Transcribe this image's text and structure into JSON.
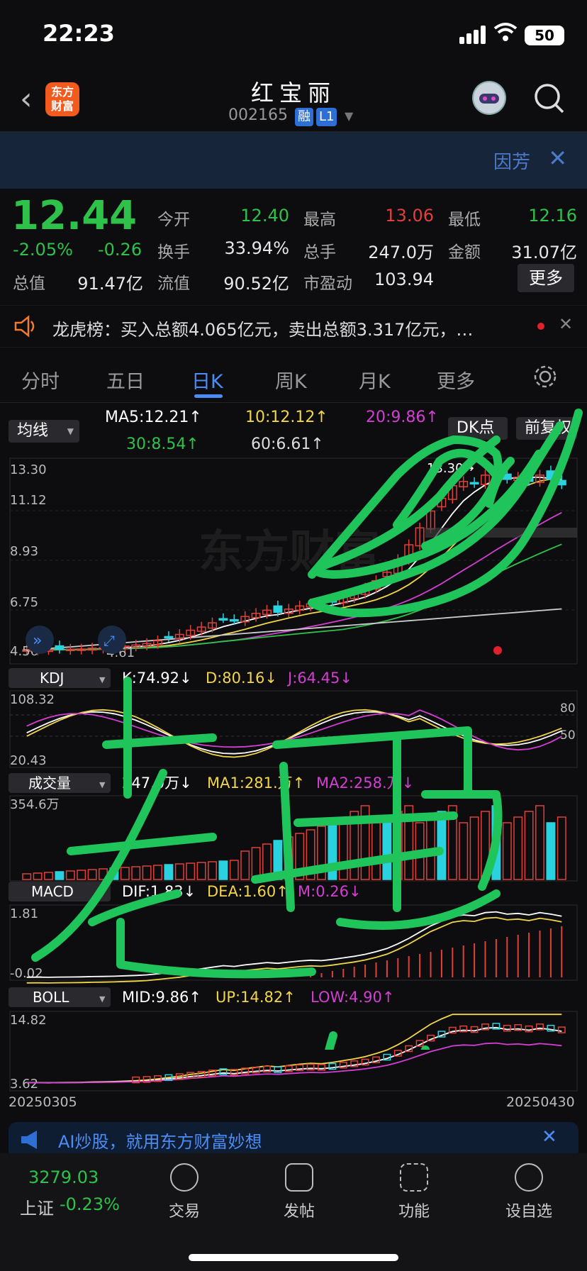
{
  "status": {
    "time": "22:23",
    "battery": "50"
  },
  "header": {
    "stock_name": "红宝丽",
    "stock_code": "002165",
    "tag_margin": "融",
    "tag_level": "L1",
    "logo_line1": "东方",
    "logo_line2": "财富"
  },
  "banner": {
    "text": "因芳"
  },
  "quote": {
    "price": "12.44",
    "pct": "-2.05%",
    "chg": "-0.26",
    "fields": [
      {
        "label": "今开",
        "value": "12.40",
        "color": "#2ec24a"
      },
      {
        "label": "最高",
        "value": "13.06",
        "color": "#e0403a"
      },
      {
        "label": "最低",
        "value": "12.16",
        "color": "#2ec24a"
      },
      {
        "label": "换手",
        "value": "33.94%",
        "color": "#e6e6e6"
      },
      {
        "label": "总手",
        "value": "247.0万",
        "color": "#e6e6e6"
      },
      {
        "label": "金额",
        "value": "31.07亿",
        "color": "#e6e6e6"
      },
      {
        "label": "总值",
        "value": "91.47亿",
        "color": "#e6e6e6"
      },
      {
        "label": "流值",
        "value": "90.52亿",
        "color": "#e6e6e6"
      },
      {
        "label": "市盈动",
        "value": "103.94",
        "color": "#e6e6e6"
      }
    ],
    "more_label": "更多"
  },
  "dragon": {
    "text": "龙虎榜：买入总额4.065亿元，卖出总额3.317亿元，…"
  },
  "tabs": [
    {
      "label": "分时",
      "active": false
    },
    {
      "label": "五日",
      "active": false
    },
    {
      "label": "日K",
      "active": true
    },
    {
      "label": "周K",
      "active": false
    },
    {
      "label": "月K",
      "active": false
    },
    {
      "label": "更多",
      "active": false
    }
  ],
  "kline": {
    "indicator": "均线",
    "ma5": "MA5:12.21↑",
    "ma10": "10:12.12↑",
    "ma20": "20:9.86↑",
    "ma30": "30:8.54↑",
    "ma60": "60:6.61↑",
    "dk": "DK点",
    "fq": "前复权",
    "y_ticks": [
      "13.30",
      "11.12",
      "8.93",
      "6.75",
      "4.56"
    ],
    "max_label": "13.30→",
    "min_label": "4.61",
    "watermark": "东方财富"
  },
  "kdj": {
    "name": "KDJ",
    "k": "K:74.92↓",
    "d": "D:80.16↓",
    "j": "J:64.45↓",
    "top": "108.32",
    "bottom": "20.43",
    "level_hi": "80",
    "level_lo": "50"
  },
  "volume": {
    "name": "成交量",
    "v": "247.0万↓",
    "ma1": "MA1:281.万↑",
    "ma2": "MA2:258.万↓",
    "top": "354.6万"
  },
  "macd": {
    "name": "MACD",
    "dif": "DIF:1.83↓",
    "dea": "DEA:1.60↑",
    "m": "M:0.26↓",
    "top": "1.81",
    "bottom": "-0.02"
  },
  "boll": {
    "name": "BOLL",
    "mid": "MID:9.86↑",
    "up": "UP:14.82↑",
    "low": "LOW:4.90↑",
    "top": "14.82",
    "bottom": "3.62",
    "date_start": "20250305",
    "date_end": "20250430"
  },
  "ad": {
    "text": "AI炒股，就用东方财富妙想"
  },
  "bottom_nav": {
    "index_value": "3279.03",
    "index_name": "上证",
    "index_pct": "-0.23%",
    "items": [
      "交易",
      "发帖",
      "功能",
      "设自选"
    ]
  },
  "colors": {
    "up": "#e0403a",
    "down": "#2ec24a",
    "accent": "#4c8cf5",
    "doodle": "#1fc45a"
  }
}
